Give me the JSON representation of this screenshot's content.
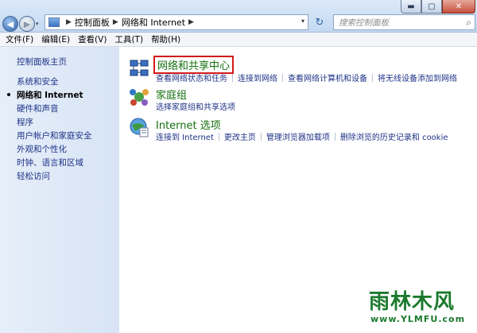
{
  "window_controls": {
    "minimize": "▬",
    "maximize": "▢",
    "close": "✕"
  },
  "nav": {
    "back_glyph": "◀",
    "forward_glyph": "▶",
    "recent_glyph": "▾"
  },
  "address": {
    "crumbs": [
      "控制面板",
      "网络和 Internet"
    ],
    "sep": "▶",
    "dropdown": "▾"
  },
  "refresh_glyph": "↻",
  "search": {
    "placeholder": "搜索控制面板",
    "icon": "⌕"
  },
  "menu": [
    "文件(F)",
    "编辑(E)",
    "查看(V)",
    "工具(T)",
    "帮助(H)"
  ],
  "sidebar": {
    "home": "控制面板主页",
    "items": [
      {
        "label": "系统和安全",
        "active": false
      },
      {
        "label": "网络和 Internet",
        "active": true
      },
      {
        "label": "硬件和声音",
        "active": false
      },
      {
        "label": "程序",
        "active": false
      },
      {
        "label": "用户帐户和家庭安全",
        "active": false
      },
      {
        "label": "外观和个性化",
        "active": false
      },
      {
        "label": "时钟、语言和区域",
        "active": false
      },
      {
        "label": "轻松访问",
        "active": false
      }
    ]
  },
  "categories": [
    {
      "title": "网络和共享中心",
      "icon": "network-sharing-center-icon",
      "highlighted": true,
      "links": [
        "查看网络状态和任务",
        "连接到网络",
        "查看网络计算机和设备",
        "将无线设备添加到网络"
      ]
    },
    {
      "title": "家庭组",
      "icon": "homegroup-icon",
      "highlighted": false,
      "links": [
        "选择家庭组和共享选项"
      ]
    },
    {
      "title": "Internet 选项",
      "icon": "internet-options-icon",
      "highlighted": false,
      "links": [
        "连接到 Internet",
        "更改主页",
        "管理浏览器加载项",
        "删除浏览的历史记录和 cookie"
      ]
    }
  ],
  "watermark": {
    "text": "雨林木风",
    "url": "www.YLMFU.com"
  },
  "colors": {
    "link": "#1e3287",
    "category_title": "#14700f",
    "highlight_box": "#d21a1a",
    "sidebar_bg": "#dfe9f7",
    "watermark": "#1b7a2d"
  }
}
